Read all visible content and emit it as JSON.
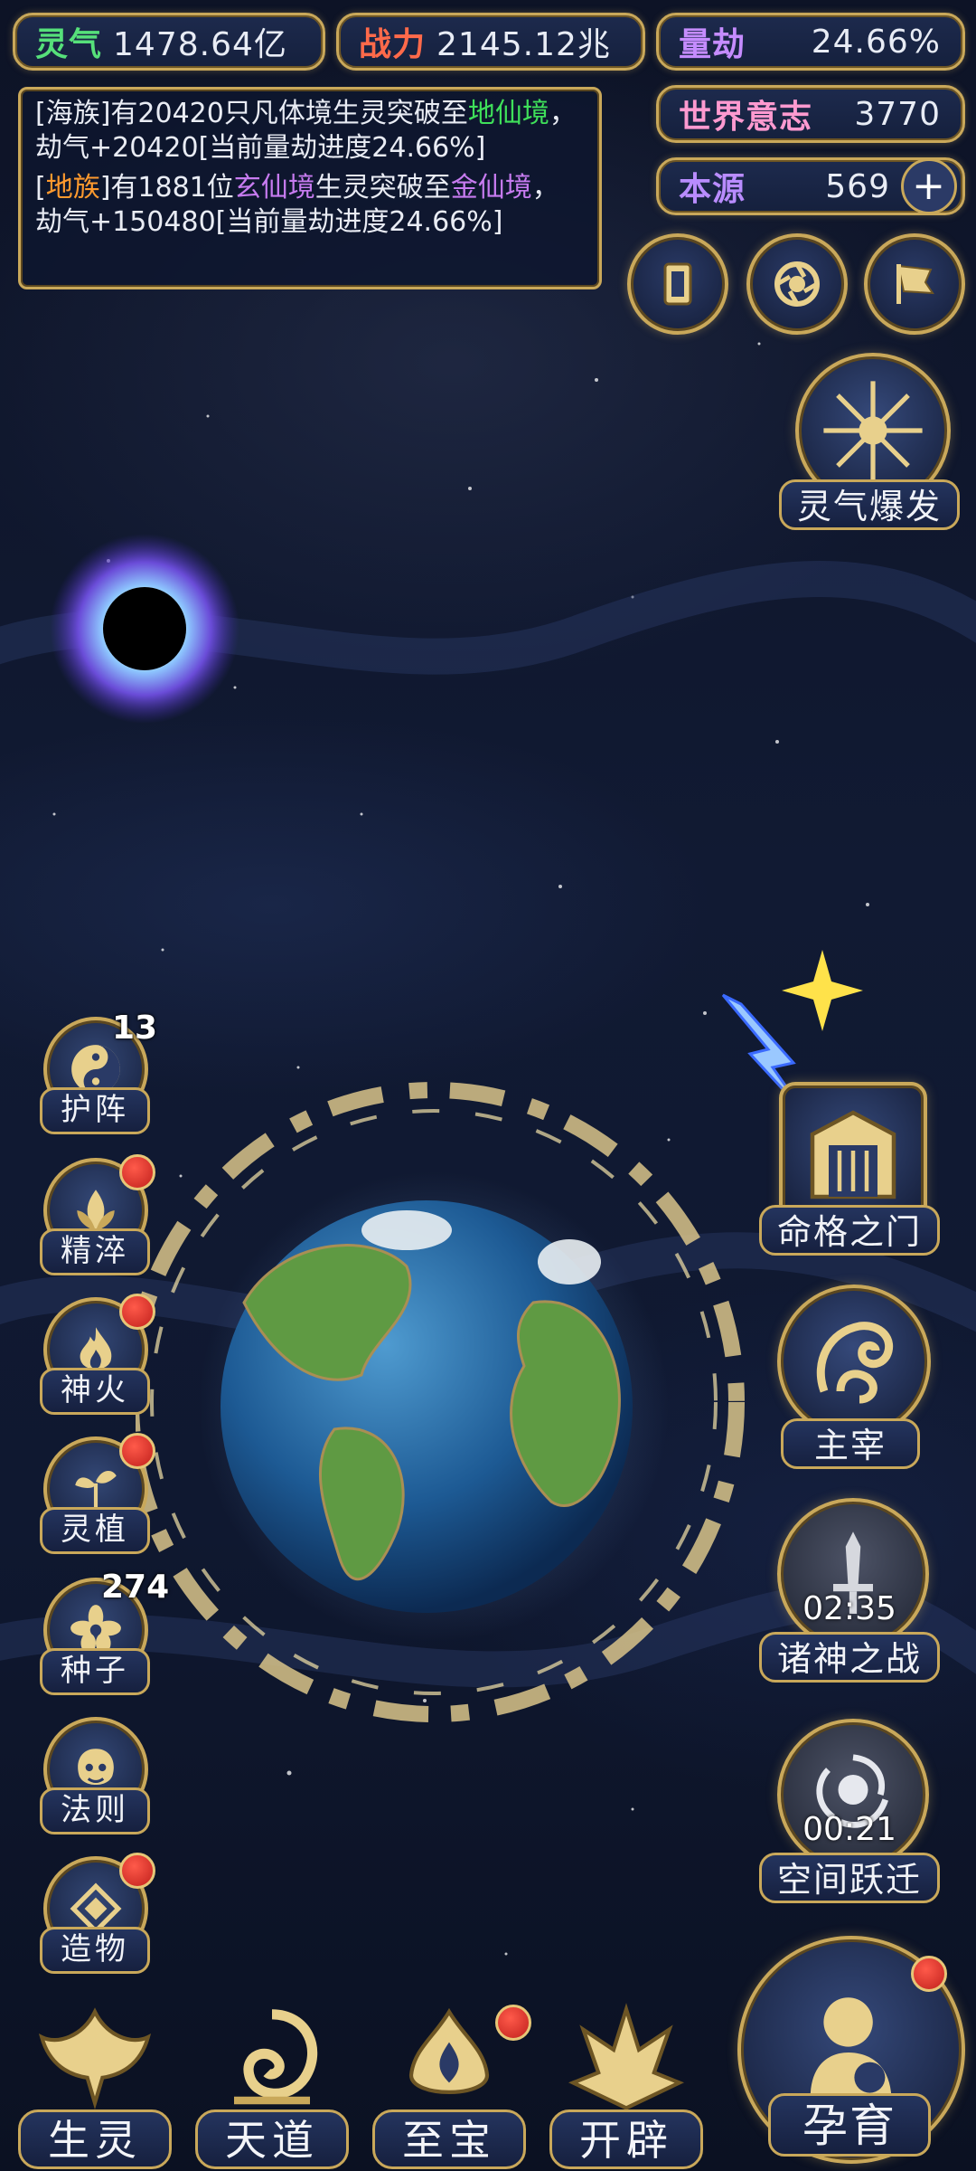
{
  "stats": {
    "lingqi": {
      "label": "灵气",
      "value": "1478.64亿",
      "color": "#56e07a"
    },
    "zhanli": {
      "label": "战力",
      "value": "2145.12兆",
      "color": "#ff6a4a"
    },
    "liangjie": {
      "label": "量劫",
      "value": "24.66%",
      "color": "#c58cff"
    },
    "shijie": {
      "label": "世界意志",
      "value": "3770",
      "color": "#ff9ad0"
    },
    "benyuan": {
      "label": "本源",
      "value": "569",
      "color": "#b98cff"
    }
  },
  "log": {
    "line1": {
      "a": "[海族]有20420只凡体境生灵突破至",
      "b": "地仙境",
      "c": "，劫气+20420[当前量劫进度24.66%]"
    },
    "line2": {
      "a": "[",
      "b": "地族",
      "c": "]有1881位",
      "d": "玄仙境",
      "e": "生灵突破至",
      "f": "金仙境",
      "g": "，劫气+150480[当前量劫进度24.66%]"
    }
  },
  "top_icons": [
    "card-icon",
    "vortex-icon",
    "flag-icon"
  ],
  "burst": {
    "label": "灵气爆发"
  },
  "left_menu": [
    {
      "label": "护阵",
      "badge": "13"
    },
    {
      "label": "精淬"
    },
    {
      "label": "神火"
    },
    {
      "label": "灵植"
    },
    {
      "label": "种子",
      "badge": "274"
    },
    {
      "label": "法则"
    },
    {
      "label": "造物"
    }
  ],
  "right_menu": {
    "mingge": {
      "label": "命格之门"
    },
    "zhuzai": {
      "label": "主宰"
    },
    "zhushen": {
      "label": "诸神之战",
      "timer": "02:35"
    },
    "kongjian": {
      "label": "空间跃迁",
      "timer": "00:21"
    }
  },
  "bottom": {
    "shengling": "生灵",
    "tiandao": "天道",
    "zhibao": "至宝",
    "kaipi": "开辟",
    "yunyu": "孕育"
  }
}
